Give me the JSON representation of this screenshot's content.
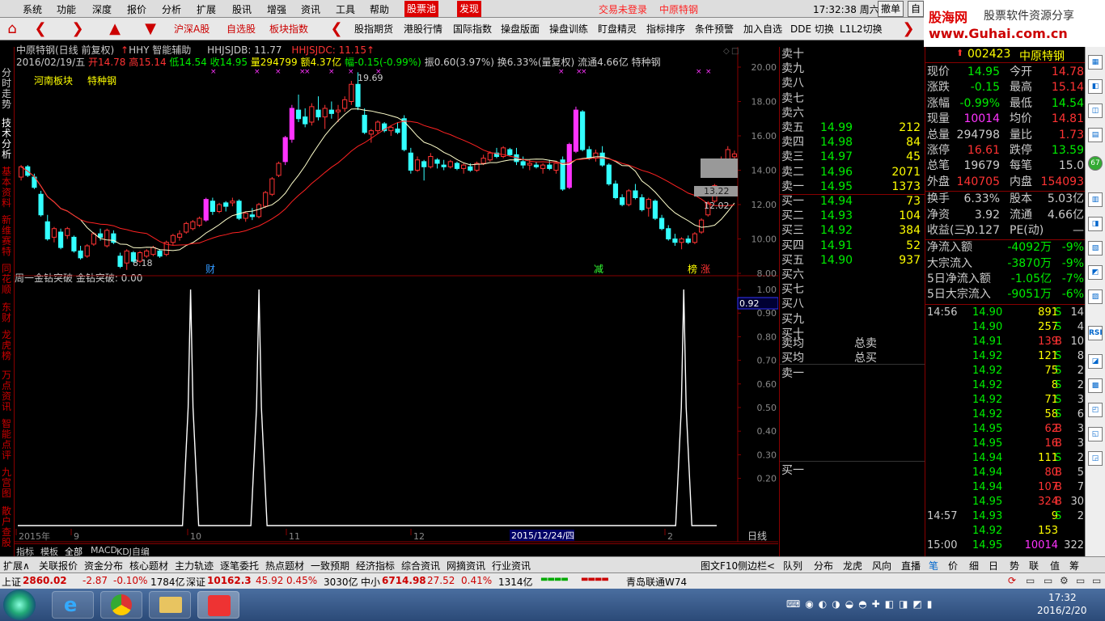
{
  "menu": {
    "items": [
      "系统",
      "功能",
      "深度",
      "报价",
      "分析",
      "扩展",
      "股讯",
      "增强",
      "资讯",
      "工具",
      "帮助"
    ],
    "red_items": [
      "股票池",
      "发现"
    ],
    "warnings": [
      "交易未登录",
      "中原特钢"
    ],
    "clock": "17:32:38 周六",
    "right_buttons": [
      "撤单",
      "自"
    ]
  },
  "toolbar": {
    "buttons": [
      "沪深A股",
      "自选股",
      "板块指数",
      "股指期货",
      "港股行情",
      "国际指数",
      "操盘版面",
      "操盘训练",
      "盯盘精灵",
      "指标排序",
      "条件预警",
      "加入自选",
      "DDE 切换",
      "L1L2切换"
    ]
  },
  "logo": {
    "line1": "股海网",
    "line2": "股票软件资源分享",
    "line3": "www.Guhai.com.cn"
  },
  "left_tabs": [
    "分时走势",
    "技术分析",
    "基本资料",
    "新维赛特",
    "同花顺",
    "东财",
    "龙虎榜",
    "万点资讯",
    "智能点评",
    "九宫图",
    "散户查股"
  ],
  "chart": {
    "header": {
      "title": "中原特钢(日线 前复权)",
      "indicator": "HHY 智能辅助",
      "hhjsjdb": "HHJSJDB: 11.77",
      "hhjsjdc": "HHJSJDC: 11.15",
      "date": "2016/02/19/五",
      "open": "开14.78",
      "high": "高15.14",
      "low": "低14.54",
      "close": "收14.95",
      "volume": "量294799",
      "amount": "额4.37亿",
      "change": "幅-0.15(-0.99%)",
      "amplitude": "振0.60(3.97%)",
      "turnover": "换6.33%(量复权)",
      "float": "流通4.66亿",
      "sector_name": "特种钢"
    },
    "tags": [
      "河南板块",
      "特种钢"
    ],
    "price_labels": {
      "high": "19.69",
      "low": "8.18",
      "mark1": "13.22",
      "mark2": "12.02"
    },
    "markers": [
      "财",
      "减",
      "榜",
      "涨"
    ],
    "lower_header": "周一金钻突破 金钻突破: 0.00",
    "lower_value_tag": "0.92",
    "upper_axis": [
      "20.00",
      "18.00",
      "16.00",
      "14.00",
      "12.00",
      "10.00",
      "8.00"
    ],
    "lower_axis": [
      "1.00",
      "0.90",
      "0.80",
      "0.70",
      "0.60",
      "0.50",
      "0.40",
      "0.30",
      "0.20"
    ],
    "date_axis": [
      "2015年",
      "9",
      "10",
      "11",
      "12",
      "2"
    ],
    "date_cursor": "2015/12/24/四",
    "period": "日线",
    "zoom_buttons": [
      "+",
      "-",
      "0"
    ]
  },
  "bottom_tabs1": [
    "指标",
    "模板",
    "全部",
    "MACD",
    "KDJ自编"
  ],
  "chart_data": {
    "type": "candlestick",
    "candles": [
      [
        13.6,
        14.3,
        13.4,
        14.2
      ],
      [
        14.2,
        14.3,
        13.6,
        13.7
      ],
      [
        13.6,
        13.8,
        12.9,
        13.0
      ],
      [
        12.6,
        12.8,
        11.3,
        11.4
      ],
      [
        11.0,
        11.4,
        9.9,
        10.0
      ],
      [
        10.1,
        10.7,
        9.8,
        10.6
      ],
      [
        10.4,
        10.6,
        9.4,
        9.5
      ],
      [
        10.2,
        10.7,
        10.0,
        10.6
      ],
      [
        10.1,
        10.2,
        9.2,
        9.3
      ],
      [
        9.3,
        9.6,
        8.8,
        8.9
      ],
      [
        9.0,
        9.7,
        8.9,
        9.6
      ],
      [
        9.7,
        10.4,
        9.6,
        10.3
      ],
      [
        10.3,
        10.6,
        9.9,
        10.1
      ],
      [
        9.6,
        10.6,
        9.5,
        10.5
      ],
      [
        10.3,
        10.5,
        9.7,
        9.8
      ],
      [
        9.0,
        9.2,
        8.3,
        8.4
      ],
      [
        8.6,
        9.4,
        8.2,
        9.3
      ],
      [
        9.2,
        9.3,
        8.6,
        8.7
      ],
      [
        8.7,
        9.3,
        8.6,
        9.2
      ],
      [
        9.0,
        9.4,
        8.9,
        9.3
      ],
      [
        9.1,
        9.6,
        9.0,
        9.5
      ],
      [
        9.3,
        9.4,
        8.9,
        9.0
      ],
      [
        9.1,
        9.9,
        9.0,
        9.8
      ],
      [
        9.8,
        10.3,
        9.6,
        10.2
      ],
      [
        10.1,
        10.5,
        9.9,
        10.3
      ],
      [
        10.4,
        11.0,
        10.3,
        10.9
      ],
      [
        10.6,
        11.1,
        10.5,
        11.0
      ],
      [
        10.8,
        11.3,
        10.7,
        11.2
      ],
      [
        11.1,
        12.4,
        11.0,
        12.3
      ],
      [
        12.2,
        12.4,
        11.4,
        11.6
      ],
      [
        11.6,
        12.1,
        11.5,
        12.0
      ],
      [
        12.1,
        12.2,
        11.6,
        11.9
      ],
      [
        12.1,
        12.4,
        11.9,
        12.2
      ],
      [
        12.2,
        12.3,
        11.1,
        11.2
      ],
      [
        11.2,
        11.6,
        11.0,
        11.5
      ],
      [
        11.4,
        11.8,
        11.1,
        11.3
      ],
      [
        11.3,
        12.1,
        11.2,
        12.0
      ],
      [
        11.9,
        12.8,
        11.8,
        12.7
      ],
      [
        12.6,
        13.6,
        12.5,
        13.5
      ],
      [
        13.7,
        14.5,
        13.6,
        14.4
      ],
      [
        14.5,
        16.0,
        14.3,
        15.9
      ],
      [
        15.8,
        17.8,
        15.6,
        17.6
      ],
      [
        17.5,
        18.4,
        16.8,
        17.0
      ],
      [
        17.1,
        17.6,
        16.5,
        16.7
      ],
      [
        16.8,
        17.9,
        16.6,
        17.7
      ],
      [
        17.5,
        18.3,
        16.9,
        17.1
      ],
      [
        17.1,
        17.8,
        16.4,
        17.6
      ],
      [
        17.5,
        18.0,
        17.0,
        17.3
      ],
      [
        17.4,
        17.8,
        16.8,
        17.5
      ],
      [
        17.6,
        18.3,
        17.4,
        18.1
      ],
      [
        18.0,
        19.2,
        17.8,
        19.0
      ],
      [
        19.0,
        19.7,
        17.5,
        17.7
      ],
      [
        17.2,
        17.6,
        16.1,
        16.2
      ],
      [
        16.1,
        16.4,
        15.6,
        16.3
      ],
      [
        16.3,
        16.9,
        16.1,
        16.8
      ],
      [
        16.7,
        16.8,
        16.2,
        16.3
      ],
      [
        16.3,
        16.6,
        16.0,
        16.5
      ],
      [
        16.4,
        16.8,
        16.1,
        16.2
      ],
      [
        17.0,
        17.2,
        15.1,
        15.2
      ],
      [
        15.0,
        15.3,
        13.8,
        14.0
      ],
      [
        14.0,
        14.8,
        13.9,
        14.6
      ],
      [
        14.5,
        14.6,
        13.4,
        14.2
      ],
      [
        14.2,
        15.0,
        14.1,
        14.8
      ],
      [
        14.6,
        14.7,
        14.1,
        14.4
      ],
      [
        14.3,
        14.6,
        14.0,
        14.2
      ],
      [
        14.2,
        14.6,
        14.1,
        14.5
      ],
      [
        14.4,
        14.5,
        14.0,
        14.1
      ],
      [
        14.1,
        14.4,
        13.8,
        14.3
      ],
      [
        14.2,
        14.4,
        13.9,
        14.0
      ],
      [
        14.0,
        14.5,
        13.9,
        14.4
      ],
      [
        14.4,
        14.9,
        14.3,
        14.7
      ],
      [
        14.6,
        15.1,
        14.5,
        15.0
      ],
      [
        15.0,
        15.3,
        14.7,
        14.8
      ],
      [
        14.8,
        15.4,
        14.7,
        15.3
      ],
      [
        15.2,
        15.3,
        14.8,
        14.9
      ],
      [
        14.9,
        15.3,
        14.3,
        14.5
      ],
      [
        14.5,
        14.8,
        14.1,
        14.3
      ],
      [
        14.3,
        14.6,
        14.0,
        14.4
      ],
      [
        14.3,
        14.5,
        14.1,
        14.2
      ],
      [
        14.1,
        14.4,
        13.8,
        14.3
      ],
      [
        14.3,
        14.6,
        14.0,
        14.1
      ],
      [
        14.0,
        14.5,
        13.8,
        14.4
      ],
      [
        14.6,
        14.8,
        12.8,
        12.9
      ],
      [
        13.0,
        15.6,
        12.9,
        15.5
      ],
      [
        15.1,
        17.7,
        15.0,
        17.5
      ],
      [
        17.4,
        17.5,
        15.1,
        15.2
      ],
      [
        15.2,
        15.4,
        14.6,
        14.7
      ],
      [
        14.7,
        15.2,
        14.5,
        15.0
      ],
      [
        15.0,
        15.4,
        14.2,
        14.3
      ],
      [
        14.3,
        14.4,
        13.1,
        13.2
      ],
      [
        13.2,
        13.4,
        12.3,
        12.4
      ],
      [
        12.4,
        12.6,
        11.9,
        12.0
      ],
      [
        12.0,
        12.9,
        11.9,
        12.8
      ],
      [
        12.8,
        13.2,
        12.3,
        12.4
      ],
      [
        12.4,
        12.6,
        11.6,
        11.7
      ],
      [
        11.8,
        12.4,
        11.3,
        12.3
      ],
      [
        12.2,
        12.3,
        11.1,
        11.2
      ],
      [
        11.2,
        11.4,
        10.5,
        10.6
      ],
      [
        10.6,
        10.8,
        9.9,
        10.0
      ],
      [
        10.0,
        10.3,
        9.6,
        9.8
      ],
      [
        9.8,
        10.1,
        9.4,
        10.0
      ],
      [
        10.0,
        10.2,
        9.7,
        9.8
      ],
      [
        9.8,
        10.4,
        9.7,
        10.3
      ],
      [
        10.4,
        11.2,
        10.3,
        11.1
      ],
      [
        11.4,
        12.2,
        11.3,
        12.1
      ],
      [
        12.2,
        13.2,
        12.1,
        13.1
      ],
      [
        14.1,
        14.8,
        13.8,
        14.6
      ],
      [
        14.6,
        15.4,
        14.5,
        15.2
      ],
      [
        14.78,
        15.14,
        14.54,
        14.95
      ]
    ],
    "ma_fast_label": "",
    "ylim": [
      8,
      20
    ],
    "signals_x": [
      0.24,
      0.335,
      0.925
    ],
    "signal_ylim": [
      0,
      1
    ]
  },
  "book": {
    "sell_labels": [
      "卖十",
      "卖九",
      "卖八",
      "卖七",
      "卖六",
      "卖五",
      "卖四",
      "卖三",
      "卖二",
      "卖一"
    ],
    "sell_prices": [
      "",
      "",
      "",
      "",
      "",
      "14.99",
      "14.98",
      "14.97",
      "14.96",
      "14.95"
    ],
    "sell_vols": [
      "",
      "",
      "",
      "",
      "",
      "212",
      "84",
      "45",
      "2071",
      "1373"
    ],
    "buy_labels": [
      "买一",
      "买二",
      "买三",
      "买四",
      "买五",
      "买六",
      "买七",
      "买八",
      "买九",
      "买十"
    ],
    "buy_prices": [
      "14.94",
      "14.93",
      "14.92",
      "14.91",
      "14.90",
      "",
      "",
      "",
      "",
      ""
    ],
    "buy_vols": [
      "73",
      "104",
      "384",
      "52",
      "937",
      "",
      "",
      "",
      "",
      ""
    ],
    "avg_sell": "卖均",
    "avg_buy": "买均",
    "total_sell": "总卖",
    "total_buy": "总买",
    "level_sell": "卖一",
    "level_buy": "买一"
  },
  "quote": {
    "code": "002423",
    "name": "中原特钢",
    "rows": [
      [
        "现价",
        "14.95",
        "今开",
        "14.78"
      ],
      [
        "涨跌",
        "-0.15",
        "最高",
        "15.14"
      ],
      [
        "涨幅",
        "-0.99%",
        "最低",
        "14.54"
      ],
      [
        "现量",
        "10014",
        "均价",
        "14.81"
      ],
      [
        "总量",
        "294798",
        "量比",
        "1.73"
      ],
      [
        "涨停",
        "16.61",
        "跌停",
        "13.59"
      ],
      [
        "总笔",
        "19679",
        "每笔",
        "15.0"
      ],
      [
        "外盘",
        "140705",
        "内盘",
        "154093"
      ],
      [
        "换手",
        "6.33%",
        "股本",
        "5.03亿"
      ],
      [
        "净资",
        "3.92",
        "流通",
        "4.66亿"
      ],
      [
        "收益(三)",
        "-0.127",
        "PE(动)",
        "—"
      ]
    ],
    "flows": [
      [
        "净流入额",
        "-4092万",
        "-9%"
      ],
      [
        "大宗流入",
        "-3870万",
        "-9%"
      ],
      [
        "5日净流入额",
        "-1.05亿",
        "-7%"
      ],
      [
        "5日大宗流入",
        "-9051万",
        "-6%"
      ]
    ],
    "ticks": [
      [
        "14:56",
        "14.90",
        "891",
        "S",
        "14"
      ],
      [
        "",
        "14.90",
        "257",
        "S",
        "4"
      ],
      [
        "",
        "14.91",
        "139",
        "B",
        "10"
      ],
      [
        "",
        "14.92",
        "121",
        "S",
        "8"
      ],
      [
        "",
        "14.92",
        "75",
        "S",
        "2"
      ],
      [
        "",
        "14.92",
        "8",
        "S",
        "2"
      ],
      [
        "",
        "14.92",
        "71",
        "S",
        "3"
      ],
      [
        "",
        "14.92",
        "58",
        "S",
        "6"
      ],
      [
        "",
        "14.95",
        "62",
        "B",
        "3"
      ],
      [
        "",
        "14.95",
        "16",
        "B",
        "3"
      ],
      [
        "",
        "14.94",
        "111",
        "S",
        "2"
      ],
      [
        "",
        "14.94",
        "80",
        "B",
        "5"
      ],
      [
        "",
        "14.94",
        "107",
        "B",
        "7"
      ],
      [
        "",
        "14.95",
        "324",
        "B",
        "30"
      ],
      [
        "14:57",
        "14.93",
        "9",
        "S",
        "2"
      ],
      [
        "",
        "14.92",
        "153",
        "",
        ""
      ],
      [
        "15:00",
        "14.95",
        "10014",
        "",
        "322"
      ]
    ]
  },
  "right_icons": [
    "RSI",
    "67"
  ],
  "bottom_tabs2": [
    "扩展∧",
    "关联报价",
    "资金分布",
    "核心题材",
    "主力轨迹",
    "逐笔委托",
    "热点题材",
    "一致预期",
    "经济指标",
    "综合资讯",
    "网摘资讯",
    "行业资讯",
    "图文F10",
    "侧边栏<",
    "队列",
    "分布",
    "龙虎",
    "风向",
    "直播",
    "笔",
    "价",
    "细",
    "日",
    "势",
    "联",
    "值",
    "筹"
  ],
  "status": {
    "sh_label": "上证",
    "sh_val": "2860.02",
    "sh_chg": "-2.87",
    "sh_pct": "-0.10%",
    "sh_amt": "1784亿",
    "sz_label": "深证",
    "sz_val": "10162.3",
    "sz_chg": "45.92",
    "sz_pct": "0.45%",
    "sz_amt": "3030亿",
    "zx_label": "中小",
    "zx_val": "6714.98",
    "zx_chg": "27.52",
    "zx_pct": "0.41%",
    "zx_amt": "1314亿",
    "broker": "青岛联通W74"
  },
  "taskbar": {
    "time": "17:32",
    "date": "2016/2/20"
  },
  "colors": {
    "up": "#ff3333",
    "down": "#33ffff",
    "magenta": "#ff33ff",
    "yellow": "#ffff00",
    "green": "#00ee00"
  }
}
